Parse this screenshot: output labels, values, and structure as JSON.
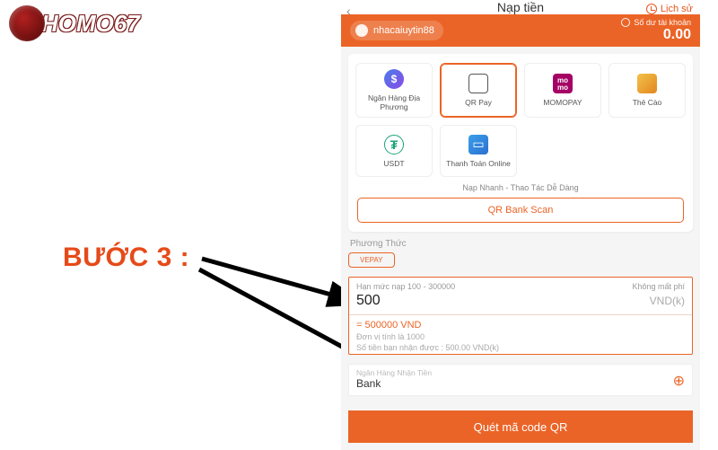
{
  "logo": {
    "text": "HOMO67"
  },
  "annotation": {
    "step_label": "BƯỚC 3 :"
  },
  "topbar": {
    "title": "Nạp tiền",
    "history_label": "Lịch sử"
  },
  "account": {
    "username": "nhacaiuytin88",
    "balance_label": "Số dư tài khoản",
    "balance_value": "0.00"
  },
  "methods": {
    "items": [
      {
        "id": "local-bank",
        "label": "Ngân Hàng Địa Phương"
      },
      {
        "id": "qrpay",
        "label": "QR Pay"
      },
      {
        "id": "momo",
        "label": "MOMOPAY"
      },
      {
        "id": "thecao",
        "label": "Thẻ Cào"
      },
      {
        "id": "usdt",
        "label": "USDT"
      },
      {
        "id": "online",
        "label": "Thanh Toán Online"
      }
    ],
    "hint": "Nạp Nhanh - Thao Tác Dễ Dàng",
    "qr_scan_label": "QR Bank Scan"
  },
  "phuong_thuc": {
    "label": "Phương Thức",
    "chip": "VEPAY"
  },
  "amount": {
    "limit_label": "Hạn mức nạp 100 - 300000",
    "fee_label": "Không mất phí",
    "value": "500",
    "unit": "VND(k)",
    "converted": "= 500000 VND",
    "unit_note": "Đơn vị tính là 1000",
    "receive_note": "Số tiền bạn nhận được : 500.00 VND(k)"
  },
  "bank": {
    "label": "Ngân Hàng Nhận Tiền",
    "value": "Bank"
  },
  "cta": {
    "label": "Quét mã code QR"
  },
  "colors": {
    "accent": "#eb6427"
  }
}
